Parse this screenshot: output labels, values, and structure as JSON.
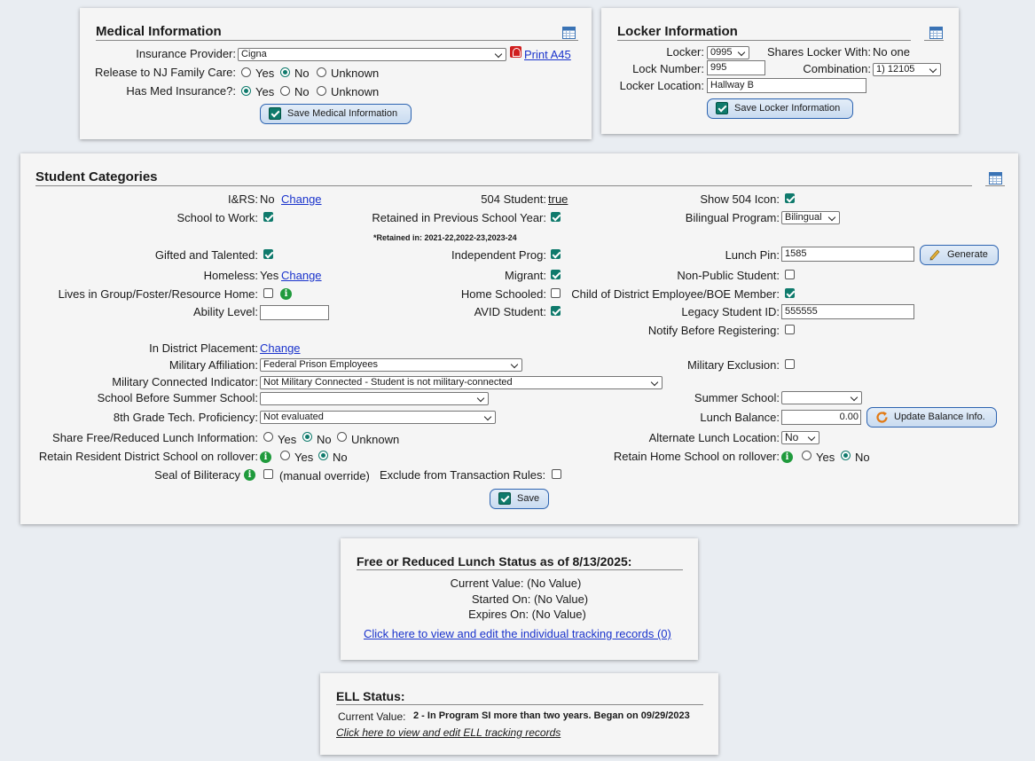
{
  "medical": {
    "title": "Medical Information",
    "insurance_label": "Insurance Provider:",
    "insurance_value": "Cigna",
    "print_label": "Print A45",
    "release_label": "Release to NJ Family Care:",
    "has_ins_label": "Has Med Insurance?:",
    "yes": "Yes",
    "no": "No",
    "unknown": "Unknown",
    "release_selected": "No",
    "has_ins_selected": "Yes",
    "save_label": "Save Medical Information"
  },
  "locker": {
    "title": "Locker Information",
    "locker_label": "Locker:",
    "locker_value": "0995",
    "shares_label": "Shares Locker With:",
    "shares_value": "No one",
    "lock_number_label": "Lock Number:",
    "lock_number_value": "995",
    "combination_label": "Combination:",
    "combination_value": "1)  12105",
    "location_label": "Locker Location:",
    "location_value": "Hallway B",
    "save_label": "Save Locker Information"
  },
  "categories": {
    "title": "Student Categories",
    "irs_label": "I&RS:",
    "irs_value": "No",
    "change": "Change",
    "s504_label": "504 Student:",
    "s504_value": "true",
    "show504_label": "Show 504 Icon:",
    "show504": true,
    "stw_label": "School to Work:",
    "stw": true,
    "retained_label": "Retained in Previous School Year:",
    "retained": true,
    "bilingual_label": "Bilingual Program:",
    "bilingual_value": "Bilingual",
    "retained_in": "*Retained in: 2021-22,2022-23,2023-24",
    "gifted_label": "Gifted and Talented:",
    "gifted": true,
    "indep_label": "Independent Prog:",
    "indep": true,
    "lunchpin_label": "Lunch Pin:",
    "lunchpin_value": "1585",
    "generate_label": "Generate",
    "homeless_label": "Homeless:",
    "homeless_value": "Yes",
    "migrant_label": "Migrant:",
    "migrant": true,
    "nonpublic_label": "Non-Public Student:",
    "nonpublic": false,
    "group_label": "Lives in Group/Foster/Resource Home:",
    "group": false,
    "homeschool_label": "Home Schooled:",
    "homeschool": false,
    "childemp_label": "Child of District Employee/BOE Member:",
    "childemp": true,
    "ability_label": "Ability Level:",
    "ability_value": "",
    "avid_label": "AVID Student:",
    "avid": true,
    "legacy_label": "Legacy Student ID:",
    "legacy_value": "555555",
    "notify_label": "Notify Before Registering:",
    "notify": false,
    "placement_label": "In District Placement:",
    "placement_link": "Change",
    "milaff_label": "Military Affiliation:",
    "milaff_value": "Federal Prison Employees",
    "milexcl_label": "Military Exclusion:",
    "milexcl": false,
    "milconn_label": "Military Connected Indicator:",
    "milconn_value": "Not Military Connected - Student is not military-connected",
    "sbss_label": "School Before Summer School:",
    "sbss_value": "",
    "summer_label": "Summer School:",
    "summer_value": "",
    "tech_label": "8th Grade Tech. Proficiency:",
    "tech_value": "Not evaluated",
    "lunchbal_label": "Lunch Balance:",
    "lunchbal_value": "0.00",
    "update_label": "Update Balance Info.",
    "share_label": "Share Free/Reduced Lunch Information:",
    "share_selected": "No",
    "altlunch_label": "Alternate Lunch Location:",
    "altlunch_value": "No",
    "retain_res_label": "Retain Resident District School on rollover:",
    "retain_res_selected": "No",
    "retain_home_label": "Retain Home School on rollover:",
    "retain_home_selected": "No",
    "seal_label": "Seal of Biliteracy",
    "seal": false,
    "manual_override": "(manual override)",
    "excl_label": "Exclude from Transaction Rules:",
    "excl": false,
    "yes": "Yes",
    "no": "No",
    "unknown": "Unknown",
    "save_label": "Save"
  },
  "frl": {
    "title": "Free or Reduced Lunch Status as of 8/13/2025:",
    "current": "Current Value: (No Value)",
    "started": "Started On: (No Value)",
    "expires": "Expires On: (No Value)",
    "link": "Click here to view and edit the individual tracking records (0)"
  },
  "ell": {
    "title": "ELL Status:",
    "current_label": "Current Value:",
    "current_value": "2 - In Program SI more than two years. Began on 09/29/2023",
    "link": "Click here to view and edit ELL tracking records"
  },
  "colors": {
    "accent": "#0f7a6c",
    "link": "#1a33cc",
    "button_border": "#2c63b0"
  }
}
